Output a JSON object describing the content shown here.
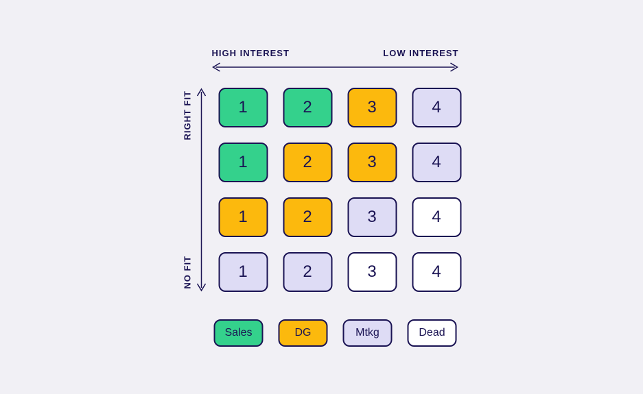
{
  "axes": {
    "xLeft": "HIGH INTEREST",
    "xRight": "LOW INTEREST",
    "yTop": "RIGHT FIT",
    "yBottom": "NO FIT"
  },
  "categories": {
    "sales": {
      "label": "Sales",
      "color": "#34d18c"
    },
    "dg": {
      "label": "DG",
      "color": "#fcb90d"
    },
    "mktg": {
      "label": "Mtkg",
      "color": "#dedcf5"
    },
    "dead": {
      "label": "Dead",
      "color": "#ffffff"
    }
  },
  "grid": [
    [
      {
        "num": "1",
        "cat": "sales"
      },
      {
        "num": "2",
        "cat": "sales"
      },
      {
        "num": "3",
        "cat": "dg"
      },
      {
        "num": "4",
        "cat": "mktg"
      }
    ],
    [
      {
        "num": "1",
        "cat": "sales"
      },
      {
        "num": "2",
        "cat": "dg"
      },
      {
        "num": "3",
        "cat": "dg"
      },
      {
        "num": "4",
        "cat": "mktg"
      }
    ],
    [
      {
        "num": "1",
        "cat": "dg"
      },
      {
        "num": "2",
        "cat": "dg"
      },
      {
        "num": "3",
        "cat": "mktg"
      },
      {
        "num": "4",
        "cat": "dead"
      }
    ],
    [
      {
        "num": "1",
        "cat": "mktg"
      },
      {
        "num": "2",
        "cat": "mktg"
      },
      {
        "num": "3",
        "cat": "dead"
      },
      {
        "num": "4",
        "cat": "dead"
      }
    ]
  ],
  "colors": {
    "ink": "#1a1353"
  }
}
